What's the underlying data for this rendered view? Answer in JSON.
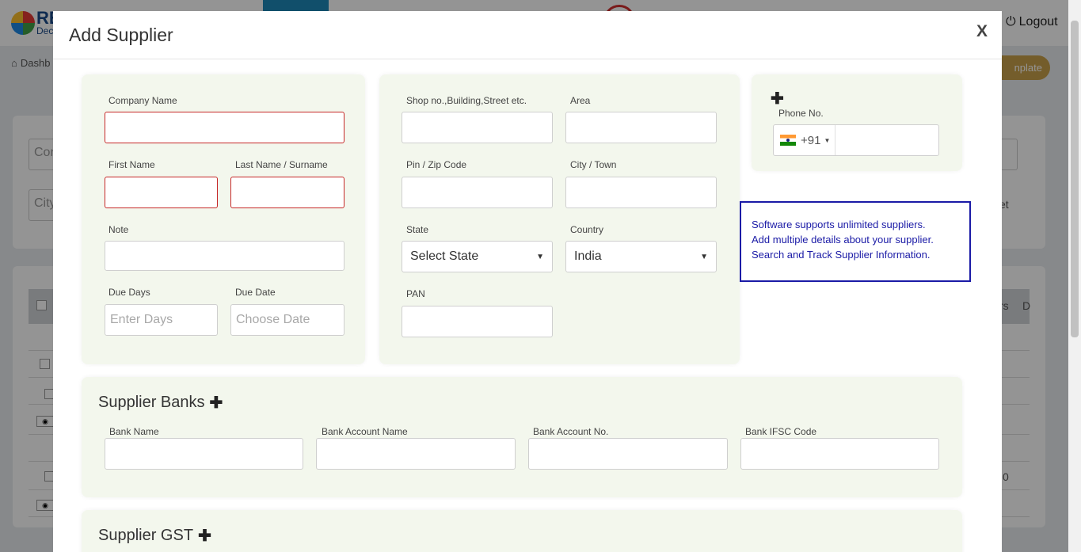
{
  "background": {
    "logo_text": "RE",
    "logo_sub": "Dec",
    "logout_label": "Logout",
    "breadcrumb": "Dashb",
    "template_btn": "nplate",
    "filter_company_placeholder": "Com",
    "filter_city_placeholder": "City",
    "filter_right_text": "et",
    "table_header_right": "rs",
    "table_header_d": "D",
    "row_value": "0"
  },
  "modal": {
    "title": "Add Supplier",
    "close_label": "X"
  },
  "basic": {
    "company_name_label": "Company Name",
    "first_name_label": "First Name",
    "last_name_label": "Last Name / Surname",
    "note_label": "Note",
    "due_days_label": "Due Days",
    "due_days_placeholder": "Enter Days",
    "due_date_label": "Due Date",
    "due_date_placeholder": "Choose Date"
  },
  "address": {
    "shop_label": "Shop no.,Building,Street etc.",
    "area_label": "Area",
    "pin_label": "Pin / Zip Code",
    "city_label": "City / Town",
    "state_label": "State",
    "state_value": "Select State",
    "country_label": "Country",
    "country_value": "India",
    "pan_label": "PAN"
  },
  "phone": {
    "add_icon": "plus-icon",
    "label": "Phone No.",
    "dial_code": "+91"
  },
  "info_box": {
    "line1": "Software supports unlimited suppliers.",
    "line2": "Add multiple details about your supplier.",
    "line3": "Search and Track Supplier Information."
  },
  "banks": {
    "title": "Supplier Banks",
    "bank_name_label": "Bank Name",
    "account_name_label": "Bank Account Name",
    "account_no_label": "Bank Account No.",
    "ifsc_label": "Bank IFSC Code"
  },
  "gst": {
    "title": "Supplier GST"
  },
  "colors": {
    "card_bg": "#f3f7ed",
    "required_border": "#c62828",
    "info_border": "#1a1aa6"
  }
}
